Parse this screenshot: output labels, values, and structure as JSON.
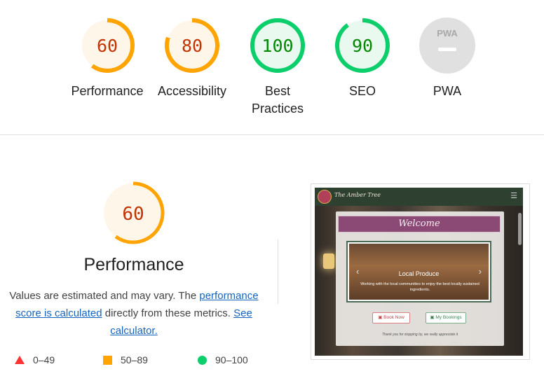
{
  "gauges": [
    {
      "score": "60",
      "label": "Performance",
      "status": "average"
    },
    {
      "score": "80",
      "label": "Accessibility",
      "status": "average"
    },
    {
      "score": "100",
      "label": "Best Practices",
      "status": "pass"
    },
    {
      "score": "90",
      "label": "SEO",
      "status": "pass"
    },
    {
      "score": "",
      "label": "PWA",
      "badge": "PWA",
      "status": "na"
    }
  ],
  "colors": {
    "average": "#ffa400",
    "average_text": "#c33300",
    "average_bg": "#fff6ea",
    "pass": "#0cce6b",
    "pass_text": "#008800",
    "pass_bg": "#e9f9ef",
    "fail": "#ff3333",
    "na_bg": "#e0e0e0",
    "link": "#1565c0"
  },
  "performance": {
    "score": "60",
    "title": "Performance",
    "desc_part1": "Values are estimated and may vary. The ",
    "link1": "performance score is calculated",
    "desc_part2": " directly from these metrics. ",
    "link2": "See calculator."
  },
  "legend": [
    {
      "range": "0–49",
      "icon": "triangle-icon"
    },
    {
      "range": "50–89",
      "icon": "square-icon"
    },
    {
      "range": "90–100",
      "icon": "circle-icon"
    }
  ],
  "screenshot": {
    "site_name": "The Amber Tree",
    "welcome": "Welcome",
    "carousel_title": "Local Produce",
    "carousel_subtitle": "Working with the local communities to enjoy the best locally sustained ingredients.",
    "book_now": "Book Now",
    "my_bookings": "My Bookings",
    "thanks": "Thank you for stopping by, we really appreciate it"
  }
}
